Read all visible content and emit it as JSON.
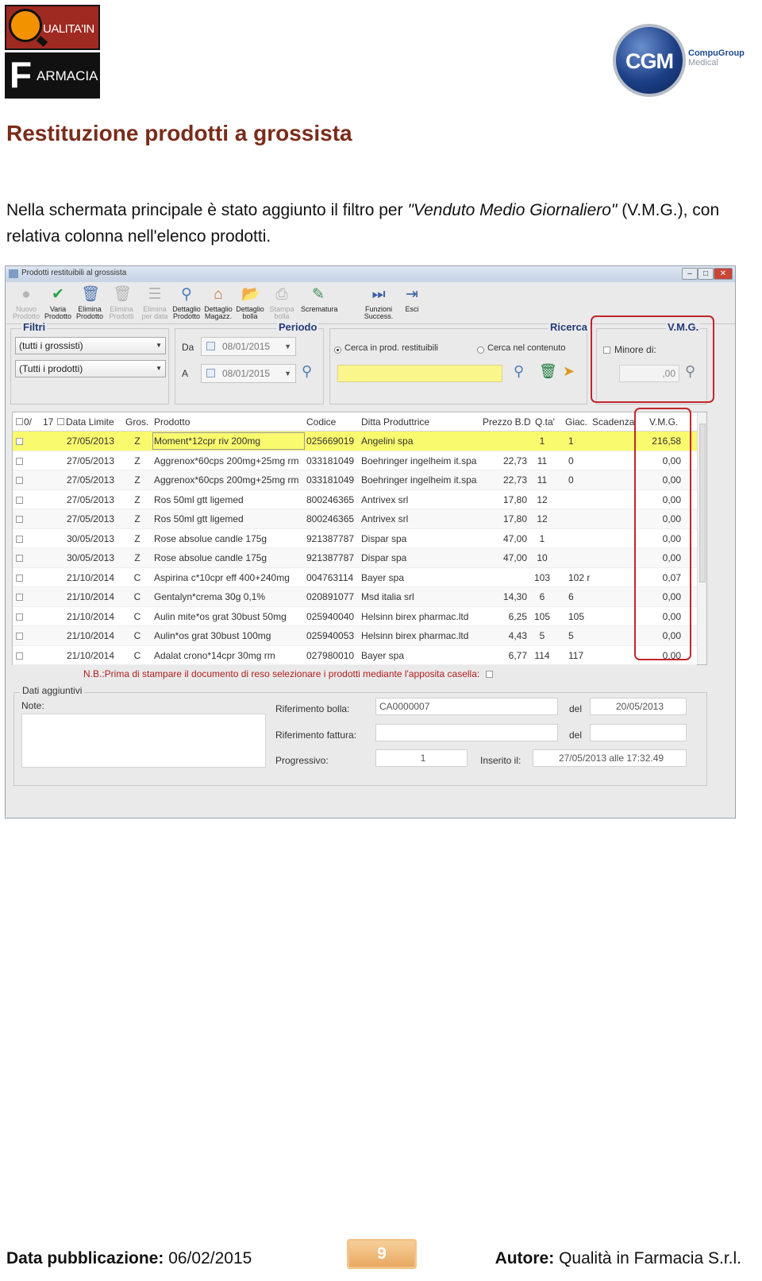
{
  "header": {
    "logo_q_text": "UALITA'IN",
    "logo_f_letter": "F",
    "logo_f_text": "ARMACIA",
    "cgm_text": "CGM",
    "cgm_brand": "CompuGroup",
    "cgm_sub": "Medical"
  },
  "page_title": "Restituzione prodotti a grossista",
  "intro": {
    "before": "Nella schermata principale è stato aggiunto il filtro per ",
    "italic": "\"Venduto Medio Giornaliero\"",
    "after": " (V.M.G.), con relativa colonna nell'elenco prodotti."
  },
  "window": {
    "title": "Prodotti restituibili al grossista",
    "toolbar": [
      {
        "icon": "circle-icon",
        "line1": "Nuovo",
        "line2": "Prodotto",
        "enabled": false
      },
      {
        "icon": "check-icon",
        "line1": "Varia",
        "line2": "Prodotto",
        "enabled": true
      },
      {
        "icon": "trash-icon",
        "line1": "Elimina",
        "line2": "Prodotto",
        "enabled": true
      },
      {
        "icon": "trash-icon",
        "line1": "Elimina",
        "line2": "Prodotti",
        "enabled": false
      },
      {
        "icon": "stack-icon",
        "line1": "Elimina",
        "line2": "per data",
        "enabled": false
      },
      {
        "icon": "search-icon",
        "line1": "Dettaglio",
        "line2": "Prodotto",
        "enabled": true
      },
      {
        "icon": "warehouse-icon",
        "line1": "Dettaglio",
        "line2": "Magazz.",
        "enabled": true
      },
      {
        "icon": "folder-icon",
        "line1": "Dettaglio",
        "line2": "bolla",
        "enabled": true
      },
      {
        "icon": "print-icon",
        "line1": "Stampa",
        "line2": "bolla",
        "enabled": false
      },
      {
        "icon": "pen-icon",
        "line1": "Scrematura",
        "line2": "",
        "enabled": true
      },
      {
        "icon": "forward-icon",
        "line1": "Funzioni",
        "line2": "Success.",
        "enabled": true
      },
      {
        "icon": "exit-icon",
        "line1": "Esci",
        "line2": "",
        "enabled": true
      }
    ],
    "filtri": {
      "title": "Filtri",
      "grossisti": "(tutti i grossisti)",
      "prodotti": "(Tutti i prodotti)"
    },
    "periodo": {
      "title": "Periodo",
      "da_label": "Da",
      "a_label": "A",
      "da_value": "08/01/2015",
      "a_value": "08/01/2015"
    },
    "ricerca": {
      "title": "Ricerca",
      "option1": "Cerca in prod. restituibili",
      "option2": "Cerca nel contenuto",
      "search_value": ""
    },
    "vmg": {
      "title": "V.M.G.",
      "checkbox_label": "Minore di:",
      "value": ",00"
    },
    "grid": {
      "headers": [
        "0/",
        "17",
        "Data Limite",
        "Gros.",
        "Prodotto",
        "Codice",
        "Ditta Produttrice",
        "Prezzo B.D",
        "Q.ta'",
        "Giac.",
        "Scadenza",
        "V.M.G."
      ],
      "rows": [
        {
          "data": "27/05/2013",
          "gros": "Z",
          "prodotto": "Moment*12cpr riv 200mg",
          "codice": "025669019",
          "ditta": "Angelini spa",
          "prezzo": "",
          "qta": "1",
          "giac": "1",
          "scad": "",
          "vmg": "216,58"
        },
        {
          "data": "27/05/2013",
          "gros": "Z",
          "prodotto": "Aggrenox*60cps 200mg+25mg rm",
          "codice": "033181049",
          "ditta": "Boehringer ingelheim it.spa",
          "prezzo": "22,73",
          "qta": "11",
          "giac": "0",
          "scad": "",
          "vmg": "0,00"
        },
        {
          "data": "27/05/2013",
          "gros": "Z",
          "prodotto": "Aggrenox*60cps 200mg+25mg rm",
          "codice": "033181049",
          "ditta": "Boehringer ingelheim it.spa",
          "prezzo": "22,73",
          "qta": "11",
          "giac": "0",
          "scad": "",
          "vmg": "0,00"
        },
        {
          "data": "27/05/2013",
          "gros": "Z",
          "prodotto": "Ros 50ml gtt ligemed",
          "codice": "800246365",
          "ditta": "Antrivex srl",
          "prezzo": "17,80",
          "qta": "12",
          "giac": "",
          "scad": "",
          "vmg": "0,00"
        },
        {
          "data": "27/05/2013",
          "gros": "Z",
          "prodotto": "Ros 50ml gtt ligemed",
          "codice": "800246365",
          "ditta": "Antrivex srl",
          "prezzo": "17,80",
          "qta": "12",
          "giac": "",
          "scad": "",
          "vmg": "0,00"
        },
        {
          "data": "30/05/2013",
          "gros": "Z",
          "prodotto": "Rose absolue candle 175g",
          "codice": "921387787",
          "ditta": "Dispar spa",
          "prezzo": "47,00",
          "qta": "1",
          "giac": "",
          "scad": "",
          "vmg": "0,00"
        },
        {
          "data": "30/05/2013",
          "gros": "Z",
          "prodotto": "Rose absolue candle 175g",
          "codice": "921387787",
          "ditta": "Dispar spa",
          "prezzo": "47,00",
          "qta": "10",
          "giac": "",
          "scad": "",
          "vmg": "0,00"
        },
        {
          "data": "21/10/2014",
          "gros": "C",
          "prodotto": "Aspirina c*10cpr eff 400+240mg",
          "codice": "004763114",
          "ditta": "Bayer spa",
          "prezzo": "",
          "qta": "103",
          "giac": "102  r",
          "scad": "",
          "vmg": "0,07"
        },
        {
          "data": "21/10/2014",
          "gros": "C",
          "prodotto": "Gentalyn*crema 30g 0,1%",
          "codice": "020891077",
          "ditta": "Msd italia srl",
          "prezzo": "14,30",
          "qta": "6",
          "giac": "6",
          "scad": "",
          "vmg": "0,00"
        },
        {
          "data": "21/10/2014",
          "gros": "C",
          "prodotto": "Aulin mite*os grat 30bust 50mg",
          "codice": "025940040",
          "ditta": "Helsinn birex pharmac.ltd",
          "prezzo": "6,25",
          "qta": "105",
          "giac": "105",
          "scad": "",
          "vmg": "0,00"
        },
        {
          "data": "21/10/2014",
          "gros": "C",
          "prodotto": "Aulin*os grat 30bust 100mg",
          "codice": "025940053",
          "ditta": "Helsinn birex pharmac.ltd",
          "prezzo": "4,43",
          "qta": "5",
          "giac": "5",
          "scad": "",
          "vmg": "0,00"
        },
        {
          "data": "21/10/2014",
          "gros": "C",
          "prodotto": "Adalat crono*14cpr 30mg rm",
          "codice": "027980010",
          "ditta": "Bayer spa",
          "prezzo": "6,77",
          "qta": "114",
          "giac": "117",
          "scad": "",
          "vmg": "0,00"
        }
      ]
    },
    "nb": "N.B.:Prima di stampare il documento di reso selezionare i prodotti mediante l'apposita casella:",
    "dati": {
      "title": "Dati aggiuntivi",
      "note_label": "Note:",
      "rif_bolla_label": "Riferimento bolla:",
      "rif_bolla_value": "CA0000007",
      "del1_label": "del",
      "del1_value": "20/05/2013",
      "rif_fattura_label": "Riferimento fattura:",
      "rif_fattura_value": "",
      "del2_label": "del",
      "del2_value": "",
      "progressivo_label": "Progressivo:",
      "progressivo_value": "1",
      "inserito_label": "Inserito il:",
      "inserito_value": "27/05/2013 alle 17:32.49"
    }
  },
  "footer": {
    "left_label": "Data pubblicazione:",
    "left_value": "06/02/2015",
    "page": "9",
    "right_label": "Autore:",
    "right_value": "Qualità in Farmacia S.r.l."
  }
}
